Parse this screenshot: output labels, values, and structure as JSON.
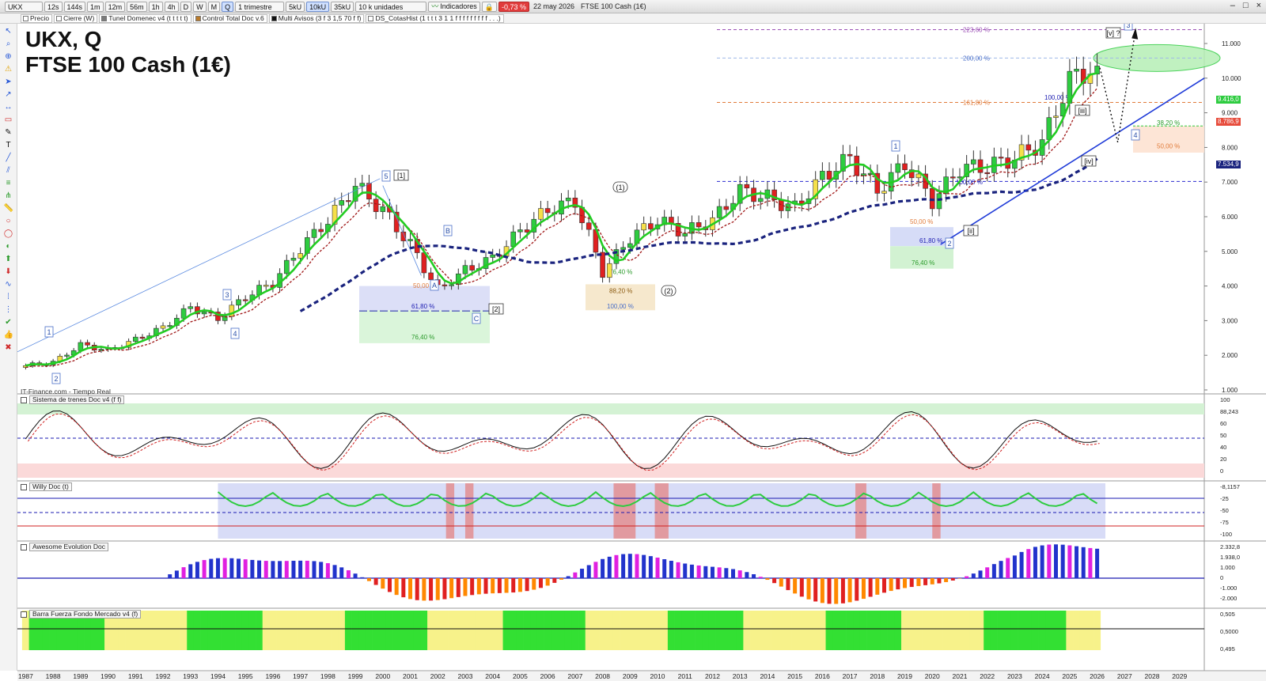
{
  "toolbar": {
    "symbol": "UKX",
    "timeframes": [
      "12s",
      "144s",
      "1m",
      "12m",
      "56m",
      "1h",
      "4h",
      "D",
      "W",
      "M",
      "Q"
    ],
    "active_timeframe": "Q",
    "period": "1 trimestre",
    "units": [
      "5kU",
      "10kU",
      "35kU"
    ],
    "active_unit": "10kU",
    "unit_select": "10 k unidades",
    "indicators_label": "Indicadores",
    "change": "-0,73 %",
    "date": "22 may 2026",
    "instrument": "FTSE 100 Cash (1€)"
  },
  "indicator_bar": [
    {
      "label": "Precio",
      "color": "#ffffff"
    },
    {
      "label": "Cierre (W)",
      "color": "#ffffff"
    },
    {
      "label": "Tunel Domenec v4 (t t t t t)",
      "color": "#7a7a7a"
    },
    {
      "label": "Control Total Doc v.6",
      "color": "#b97a2a"
    },
    {
      "label": "Multi Avisos (3 f 3 1,5 70 f f)",
      "color": "#111111"
    },
    {
      "label": "DS_CotasHist (1 t t t 3 1 1 f f f f f f f f f . . .)",
      "color": "#ffffff"
    }
  ],
  "title_line1": "UKX, Q",
  "title_line2": "FTSE 100 Cash (1€)",
  "source": "IT-Finance.com - Tiempo Real",
  "price_axis_labels": [
    "11.000",
    "10.000",
    "9.000",
    "8.000",
    "7.000",
    "6.000",
    "5.000",
    "4.000",
    "3.000",
    "2.000",
    "1.000"
  ],
  "price_tags": [
    {
      "text": "9.416,0",
      "color": "#2ecc40"
    },
    {
      "text": "8.786,9",
      "color": "#e74c3c"
    },
    {
      "text": "7.534,9",
      "color": "#1a237e"
    }
  ],
  "fib_labels": {
    "top": [
      "223,60 %",
      "200,00 %",
      "161,80 %",
      "100,00 %",
      "38,20 %",
      "50,00 %"
    ],
    "mid_2020": [
      "100,00 %",
      "50,00 %",
      "61,80 %",
      "76,40 %"
    ],
    "mid_2008": [
      "76,40 %",
      "88,20 %",
      "100,00 %"
    ],
    "low_2002": [
      "50,00 %",
      "61,80 %",
      "76,40 %"
    ]
  },
  "wave_labels": {
    "boxed": [
      "1",
      "2",
      "3",
      "4",
      "5",
      "A",
      "B",
      "C",
      "1",
      "2",
      "3",
      "4"
    ],
    "bracket": [
      "[1]",
      "[2]",
      "[ii]",
      "[iii]",
      "[iv]",
      "[v] ?"
    ],
    "paren": [
      "(1)",
      "(2)"
    ]
  },
  "panels": [
    {
      "name": "Sistema de trenes Doc v4 (f f)",
      "axis": [
        "100",
        "88,243",
        "60",
        "50",
        "40",
        "20",
        "0"
      ]
    },
    {
      "name": "Willy Doc (t)",
      "axis": [
        "-8,1157",
        "-25",
        "-50",
        "-75",
        "-100"
      ]
    },
    {
      "name": "Awesome Evolution Doc",
      "axis": [
        "2.332,8",
        "1.938,0",
        "1.000",
        "0",
        "-1.000",
        "-2.000"
      ]
    },
    {
      "name": "Barra Fuerza Fondo Mercado v4 (f)",
      "axis": [
        "0,505",
        "0,5000",
        "0,495"
      ]
    }
  ],
  "years": [
    "1987",
    "1988",
    "1989",
    "1990",
    "1991",
    "1992",
    "1993",
    "1994",
    "1995",
    "1996",
    "1997",
    "1998",
    "1999",
    "2000",
    "2001",
    "2002",
    "2003",
    "2004",
    "2005",
    "2006",
    "2007",
    "2008",
    "2009",
    "2010",
    "2011",
    "2012",
    "2013",
    "2014",
    "2015",
    "2016",
    "2017",
    "2018",
    "2019",
    "2020",
    "2021",
    "2022",
    "2023",
    "2024",
    "2025",
    "2026",
    "2027",
    "2028",
    "2029"
  ],
  "colors": {
    "up_candle": "#2ecc40",
    "down_candle": "#e02020",
    "neutral_candle": "#f5e04a",
    "fast_ma": "#22cc22",
    "slow_ma": "#b22222",
    "long_ma": "#1a237e",
    "trendline": "#1f3bd8"
  },
  "chart_data": {
    "type": "candlestick",
    "title": "UKX, Q — FTSE 100 Cash (1€)",
    "ylim": [
      1000,
      11500
    ],
    "quarterly_close_approx": [
      {
        "x": "1987",
        "y": 1700
      },
      {
        "x": "1988",
        "y": 1800
      },
      {
        "x": "1989",
        "y": 2300
      },
      {
        "x": "1990",
        "y": 2150
      },
      {
        "x": "1991",
        "y": 2450
      },
      {
        "x": "1992",
        "y": 2800
      },
      {
        "x": "1993",
        "y": 3400
      },
      {
        "x": "1994",
        "y": 3050
      },
      {
        "x": "1995",
        "y": 3700
      },
      {
        "x": "1996",
        "y": 4100
      },
      {
        "x": "1997",
        "y": 5100
      },
      {
        "x": "1998",
        "y": 5900
      },
      {
        "x": "1999",
        "y": 6900
      },
      {
        "x": "2000",
        "y": 6200
      },
      {
        "x": "2001",
        "y": 5200
      },
      {
        "x": "2002",
        "y": 3900
      },
      {
        "x": "2003",
        "y": 4450
      },
      {
        "x": "2004",
        "y": 4800
      },
      {
        "x": "2005",
        "y": 5600
      },
      {
        "x": "2006",
        "y": 6200
      },
      {
        "x": "2007",
        "y": 6450
      },
      {
        "x": "2008",
        "y": 4400
      },
      {
        "x": "2009",
        "y": 5400
      },
      {
        "x": "2010",
        "y": 5900
      },
      {
        "x": "2011",
        "y": 5550
      },
      {
        "x": "2012",
        "y": 5900
      },
      {
        "x": "2013",
        "y": 6750
      },
      {
        "x": "2014",
        "y": 6550
      },
      {
        "x": "2015",
        "y": 6250
      },
      {
        "x": "2016",
        "y": 7150
      },
      {
        "x": "2017",
        "y": 7700
      },
      {
        "x": "2018",
        "y": 6750
      },
      {
        "x": "2019",
        "y": 7550
      },
      {
        "x": "2020",
        "y": 6450
      },
      {
        "x": "2021",
        "y": 7400
      },
      {
        "x": "2022",
        "y": 7450
      },
      {
        "x": "2023",
        "y": 7700
      },
      {
        "x": "2024",
        "y": 8150
      },
      {
        "x": "2025",
        "y": 9950
      },
      {
        "x": "2026",
        "y": 10350
      }
    ],
    "projection": [
      {
        "x": "2026",
        "y": 10350
      },
      {
        "x": "2026.6",
        "y": 8400
      },
      {
        "x": "2027.5",
        "y": 11400
      }
    ]
  }
}
